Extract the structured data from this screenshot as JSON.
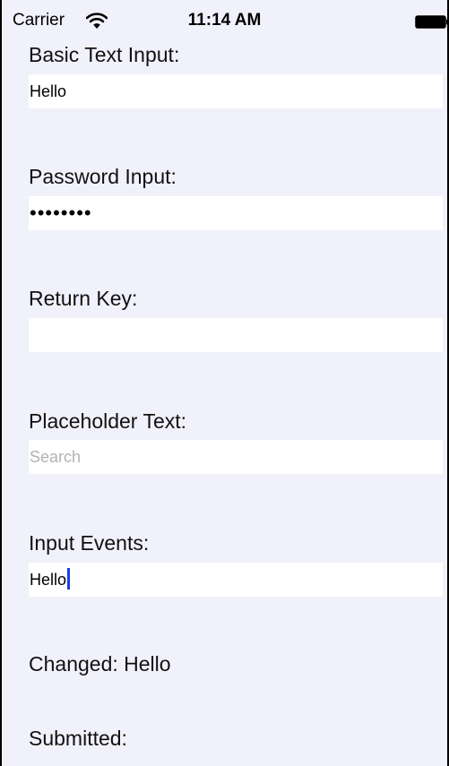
{
  "status_bar": {
    "carrier": "Carrier",
    "wifi_icon": "wifi-icon",
    "time": "11:14 AM",
    "battery_icon": "battery-icon"
  },
  "form": {
    "basic": {
      "label": "Basic Text Input:",
      "value": "Hello"
    },
    "password": {
      "label": "Password Input:",
      "masked_value": "••••••••"
    },
    "return_key": {
      "label": "Return Key:",
      "value": ""
    },
    "placeholder": {
      "label": "Placeholder Text:",
      "placeholder": "Search"
    },
    "events": {
      "label": "Input Events:",
      "value": "Hello"
    },
    "changed_text": "Changed: Hello",
    "submitted_text": "Submitted:"
  },
  "colors": {
    "background": "#f1f1fb",
    "field_background": "#ffffff",
    "caret": "#1a3ee8",
    "placeholder": "#b3b3b8"
  }
}
